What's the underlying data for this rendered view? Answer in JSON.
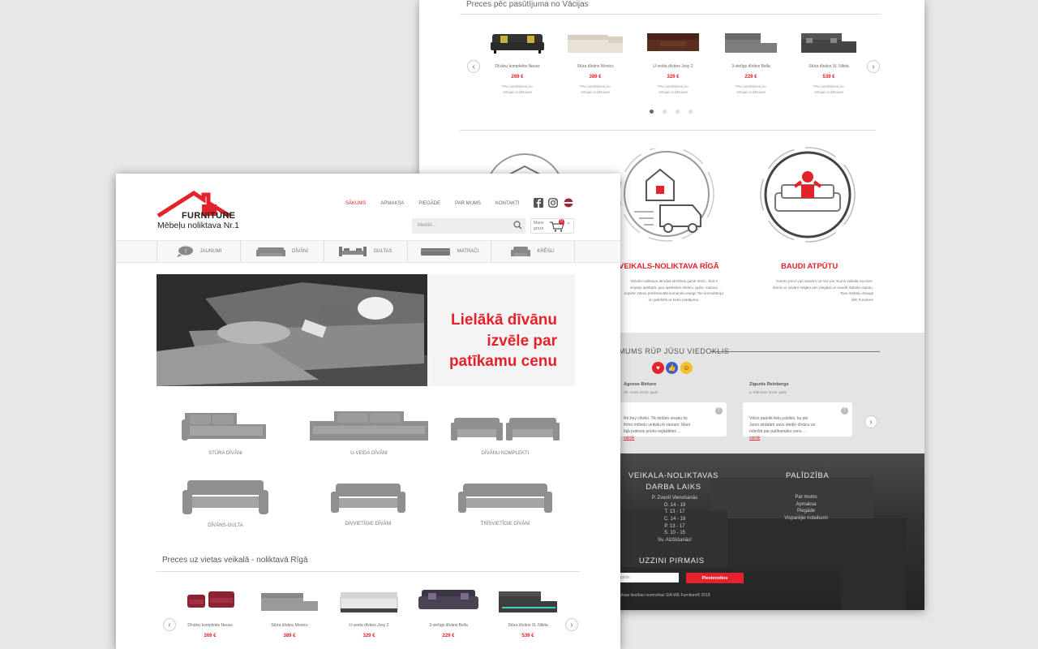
{
  "back": {
    "section_title": "Preces pēc pasūtījuma no Vācijas",
    "products": [
      {
        "name": "Dīvānu komplekts Neuss",
        "price": "269 €",
        "note": "Pēc pasūtījuma no\nVācijas noliktavas",
        "icon": "sofa-black-icon"
      },
      {
        "name": "Stūra dīvāns Monics",
        "price": "389 €",
        "note": "Pēc pasūtījuma no\nVācijas noliktavas",
        "icon": "corner-sofa-cream-icon"
      },
      {
        "name": "U-veida dīvāns Josy 2",
        "price": "329 €",
        "note": "Pēc pasūtījuma no\nVācijas noliktavas",
        "icon": "u-sofa-brown-icon"
      },
      {
        "name": "3-vietīgs dīvāns Bella",
        "price": "229 €",
        "note": "Pēc pasūtījuma no\nVācijas noliktavas",
        "icon": "sofa-grey-icon"
      },
      {
        "name": "Stūra dīvāns XL Nikita",
        "price": "539 €",
        "note": "Pēc pasūtījuma no\nVācijas noliktavas",
        "icon": "corner-sofa-dark-icon"
      }
    ],
    "features": [
      {
        "title": "VEIKALS-NOLIKTAVA RĪGĀ",
        "text": "Veikals-noliktava atrodas Brīvības gatvē 401C. Šeit ir\niespēja apskatīt, gan apsēsties dīvānu, gultu, matraci\nnopirkt. Mūsu profesionālā komanda sniegs Tev konsultāciju\nun palīdzēs ar katru jautājumu.",
        "icon": "warehouse-truck-icon"
      },
      {
        "title": "BAUDI ATPŪTU",
        "text": "Karoto preci vari saņemt uz reiz pie mums veikalā vai vien-\ndienā uz savām mājām pēc piegādi un baudīt ilstlaiku atpūtu.\nTavs mēbeļu draugs\nWE Furniture",
        "icon": "relax-icon"
      }
    ],
    "reviews_title": "MUMS RŪP JŪSU VIEDOKLIS",
    "reviews": [
      {
        "name": "Agnese Birkere",
        "date": "26. marts 2018. gads",
        "text": "Re,hey cilvēki. Tik tiešām iesaku šo\nfirmo mēbeļu veikalu ik vienam. Mani\nbija patiesis prieks iegādāties ...",
        "more": "vairāk"
      },
      {
        "name": "Zigurds Reinbergs",
        "date": "6. februāris 2018. gads",
        "text": "Vēlos pateikt lielu paldies, ka pie\nJums strādām savu ideālo dīvānu un\nnobrīkti par patīkamāko cenu ...",
        "more": "vairāk"
      }
    ],
    "footer": {
      "hours_title": "VEIKALA-NOLIKTAVAS\nDARBA LAIKS",
      "hours": [
        "P. Zvanīt Vienošanās",
        "O. 14 - 19",
        "T. 13 - 17",
        "C. 14 - 19",
        "P. 13 - 17",
        "S. 10 - 15",
        "Sv. Aizšūšanās!"
      ],
      "help_title": "PALĪDZĪBA",
      "help_links": [
        "Par mums",
        "Apmaksa",
        "Piegāde",
        "Visparējie noteikumi"
      ],
      "newsletter_title": "UZZINI PIRMAIS",
      "newsletter_placeholder": "epasts",
      "newsletter_button": "Pievienoties",
      "copyright": "Visas tiesības rezervētas SIA WE Furniture® 2018"
    }
  },
  "front": {
    "logo_brand": "FURNITURE",
    "logo_badge": "WE",
    "logo_tagline": "Mēbeļu noliktava Nr.1",
    "nav": [
      "SĀKUMS",
      "APMAKSA",
      "PIEGĀDE",
      "PAR MUMS",
      "KONTAKTI"
    ],
    "search_placeholder": "Meklēt...",
    "cart_label": "Mans grozs",
    "cart_count": "0",
    "categories": [
      {
        "label": "JAUNUMI",
        "icon": "chat-bubble-icon"
      },
      {
        "label": "DĪVĀNI",
        "icon": "sofa-icon"
      },
      {
        "label": "GULTAS",
        "icon": "bed-icon"
      },
      {
        "label": "MATRAČI",
        "icon": "mattress-icon"
      },
      {
        "label": "KRĒSLI",
        "icon": "armchair-icon"
      }
    ],
    "hero_text": [
      "Lielākā dīvānu",
      "izvēle par",
      "patīkamu cenu"
    ],
    "sofa_types": [
      "STŪRA DĪVĀNI",
      "U-VEIDA DĪVĀNI",
      "DĪVĀNU KOMPLEKTI",
      "DĪVĀNS-GULTA",
      "DIVVIETĪGIE DĪVĀNI",
      "TRĪSVIETĪGIE DĪVĀNI"
    ],
    "section_title": "Preces uz vietas veikalā - noliktavā Rīgā",
    "products": [
      {
        "name": "Dīvānu komplekts Neuss",
        "price": "269 €",
        "icon": "sofa-set-red-icon"
      },
      {
        "name": "Stūra dīvāns Monics",
        "price": "389 €",
        "icon": "corner-sofa-grey-icon"
      },
      {
        "name": "U-veida dīvāns Josy 2",
        "price": "329 €",
        "icon": "u-sofa-white-icon"
      },
      {
        "name": "3-vietīgs dīvāns Bella",
        "price": "229 €",
        "icon": "sofa-purple-icon"
      },
      {
        "name": "Stūra dīvāns XL Nikita",
        "price": "539 €",
        "icon": "corner-sofa-led-icon"
      }
    ]
  },
  "colors": {
    "accent": "#e3222b",
    "sofa_grey": "#8f8f8f",
    "footer": "#2b2b2b"
  }
}
